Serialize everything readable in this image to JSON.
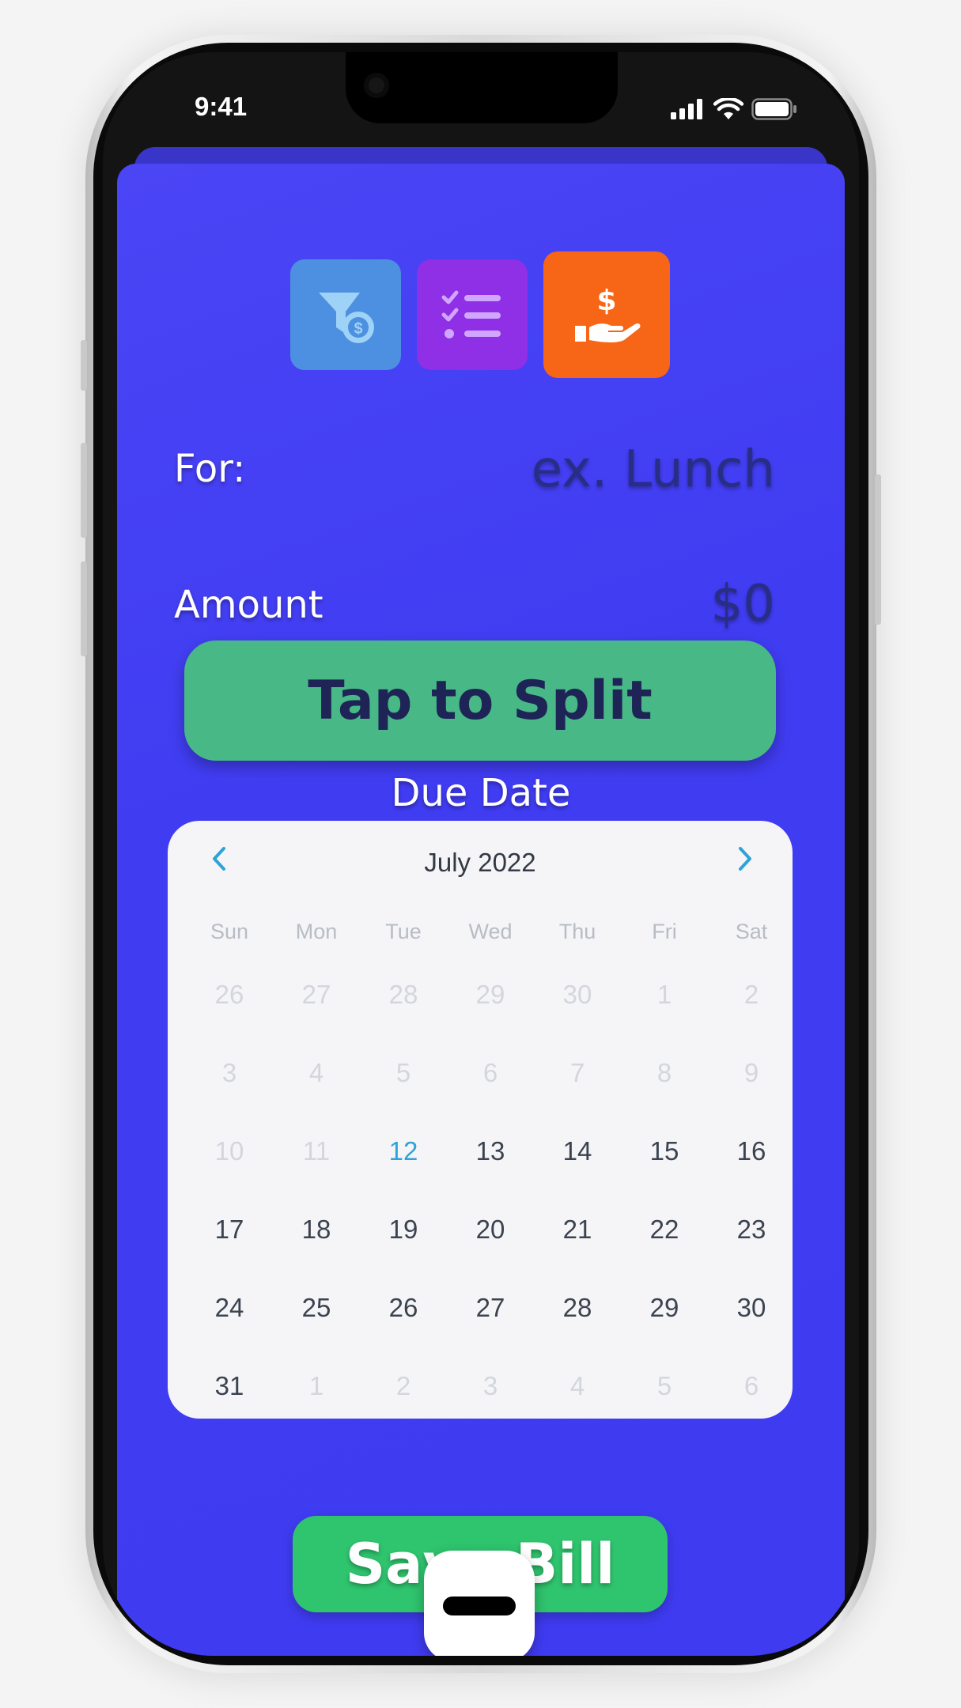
{
  "status_bar": {
    "time": "9:41"
  },
  "tabs": [
    {
      "name": "filter-money",
      "icon": "filter-money-icon",
      "color": "#4d8fe0"
    },
    {
      "name": "checklist",
      "icon": "checklist-icon",
      "color": "#8f2fe6"
    },
    {
      "name": "pay",
      "icon": "hand-dollar-icon",
      "color": "#f76516"
    }
  ],
  "form": {
    "for_label": "For:",
    "for_placeholder": "ex. Lunch",
    "amount_label": "Amount",
    "amount_value": "$0"
  },
  "split_button": "Tap to Split",
  "due_date_label": "Due Date",
  "calendar": {
    "month_title": "July 2022",
    "weekdays": [
      "Sun",
      "Mon",
      "Tue",
      "Wed",
      "Thu",
      "Fri",
      "Sat"
    ],
    "weeks": [
      [
        "26",
        "27",
        "28",
        "29",
        "30",
        "1",
        "2"
      ],
      [
        "3",
        "4",
        "5",
        "6",
        "7",
        "8",
        "9"
      ],
      [
        "10",
        "11",
        "12",
        "13",
        "14",
        "15",
        "16"
      ],
      [
        "17",
        "18",
        "19",
        "20",
        "21",
        "22",
        "23"
      ],
      [
        "24",
        "25",
        "26",
        "27",
        "28",
        "29",
        "30"
      ],
      [
        "31",
        "1",
        "2",
        "3",
        "4",
        "5",
        "6"
      ]
    ],
    "today": "12"
  },
  "save_button": "Save Bill",
  "colors": {
    "background": "#403cf2",
    "split_button": "#47b886",
    "save_button": "#2fc46e",
    "today": "#2ea3d8"
  }
}
